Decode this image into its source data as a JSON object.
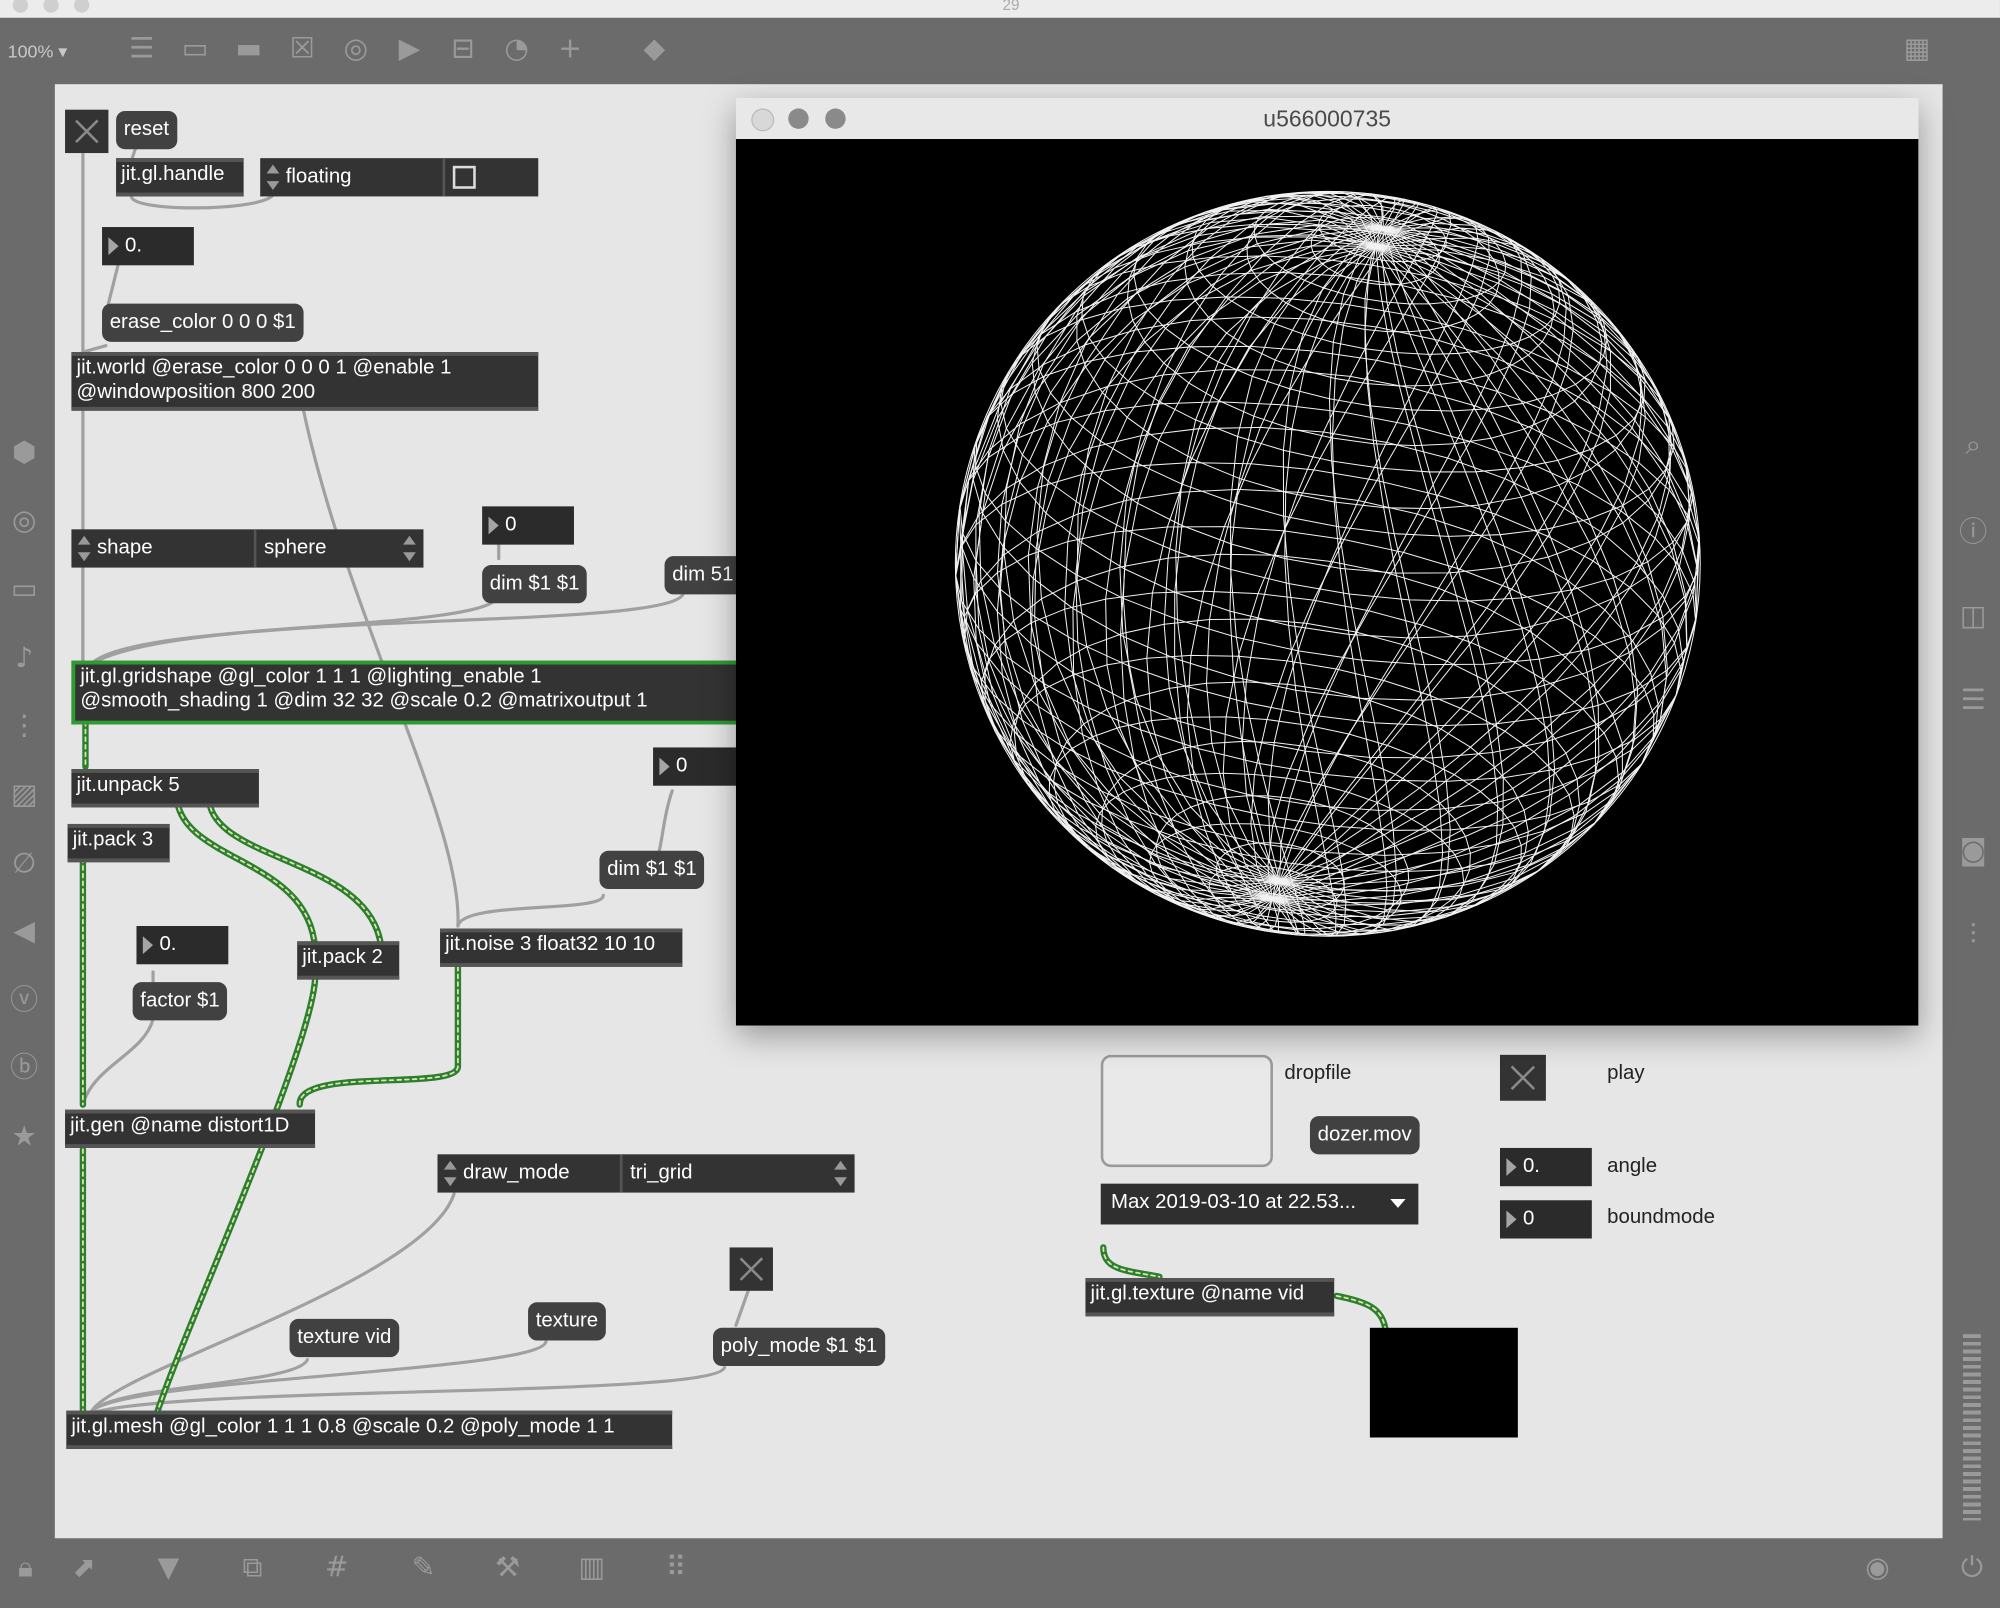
{
  "app": {
    "title": "29",
    "zoom": "100%"
  },
  "toolbar": {
    "icons": [
      "presentation-icon",
      "comment-icon",
      "message-icon",
      "toggle-icon",
      "button-icon",
      "play-icon",
      "slider-icon",
      "dial-icon",
      "add-icon",
      "paint-bucket-icon",
      "grid-keyboard-icon"
    ]
  },
  "left_sidebar": {
    "icons": [
      "cube-icon",
      "target-icon",
      "slider-icon",
      "music-note-icon",
      "sequence-icon",
      "image-icon",
      "paperclip-icon",
      "plug-icon",
      "v-circle-icon",
      "b-circle-icon",
      "star-icon"
    ]
  },
  "right_sidebar": {
    "icons": [
      "search-icon",
      "info-icon",
      "columns-icon",
      "list-icon",
      "camera-icon",
      "mixer-icon"
    ]
  },
  "bottom_bar": {
    "icons": [
      "lock-icon",
      "edit-pointer-icon",
      "presentation-mode-icon",
      "new-window-icon",
      "grid-icon",
      "inspector-icon",
      "wrench-icon",
      "keyboard-icon",
      "grid-dots-icon",
      "audio-icon",
      "power-icon"
    ]
  },
  "patch": {
    "reset_msg": "reset",
    "jit_gl_handle": "jit.gl.handle",
    "floating_attr": {
      "label": "floating"
    },
    "num_alpha": "0.",
    "erase_color_msg": "erase_color 0 0 0 $1",
    "jit_world_line1": "jit.world @erase_color 0 0 0 1 @enable 1",
    "jit_world_line2": "@windowposition 800 200",
    "shape_attr": {
      "label": "shape",
      "value": "sphere"
    },
    "num_dim": "0",
    "dim_msg_1": "dim $1 $1",
    "dim_msg_2": "dim 51",
    "gridshape_line1": "jit.gl.gridshape @gl_color 1 1 1 @lighting_enable 1",
    "gridshape_line2": "@smooth_shading 1 @dim 32 32 @scale 0.2 @matrixoutput 1",
    "jit_unpack": "jit.unpack 5",
    "jit_pack3": "jit.pack 3",
    "num_noise": "0",
    "dim_msg_3": "dim $1 $1",
    "num_factor": "0.",
    "factor_msg": "factor $1",
    "jit_pack2": "jit.pack 2",
    "jit_noise": "jit.noise 3 float32 10 10",
    "jit_gen": "jit.gen @name distort1D",
    "draw_mode_attr": {
      "label": "draw_mode",
      "value": "tri_grid"
    },
    "texture_vid_msg": "texture vid",
    "texture_msg": "texture",
    "poly_mode_msg": "poly_mode $1 $1",
    "jit_mesh": "jit.gl.mesh @gl_color 1 1 1 0.8 @scale 0.2 @poly_mode 1 1",
    "dropfile_label": "dropfile",
    "dozer_msg": "dozer.mov",
    "umenu_value": "Max 2019-03-10 at 22.53...",
    "play_label": "play",
    "num_angle": "0.",
    "angle_label": "angle",
    "num_boundmode": "0",
    "boundmode_label": "boundmode",
    "jit_gl_texture": "jit.gl.texture @name vid"
  },
  "render_window": {
    "title": "u566000735",
    "content": "wireframe sphere"
  },
  "colors": {
    "background": "#6b6b6b",
    "canvas": "#e6e6e6",
    "object": "#333333",
    "patchcord": "#a0a0a0",
    "matrix_cord": "#2d7d32",
    "selected_border": "#2e9b32"
  }
}
